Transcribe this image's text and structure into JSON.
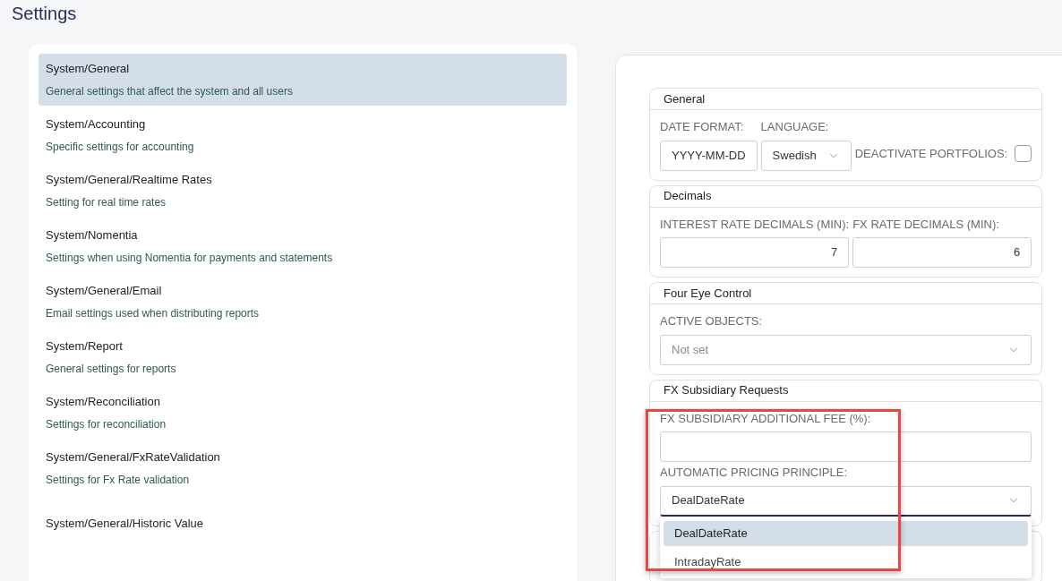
{
  "page_title": "Settings",
  "categories": [
    {
      "title": "System/General",
      "description": "General settings that affect the system and all users",
      "selected": true
    },
    {
      "title": "System/Accounting",
      "description": "Specific settings for accounting",
      "selected": false
    },
    {
      "title": "System/General/Realtime Rates",
      "description": "Setting for real time rates",
      "selected": false
    },
    {
      "title": "System/Nomentia",
      "description": "Settings when using Nomentia for payments and statements",
      "selected": false
    },
    {
      "title": "System/General/Email",
      "description": "Email settings used when distributing reports",
      "selected": false
    },
    {
      "title": "System/Report",
      "description": "General settings for reports",
      "selected": false
    },
    {
      "title": "System/Reconciliation",
      "description": "Settings for reconciliation",
      "selected": false
    },
    {
      "title": "System/General/FxRateValidation",
      "description": "Settings for Fx Rate validation",
      "selected": false
    },
    {
      "title": "System/General/Historic Value",
      "selected": false
    }
  ],
  "sections": [
    {
      "title": "General",
      "kind": "row",
      "fields": [
        {
          "kind": "text",
          "label": "DATE FORMAT:",
          "value": "YYYY-MM-DD"
        },
        {
          "kind": "select",
          "label": "LANGUAGE:",
          "value": "Swedish"
        },
        {
          "kind": "checkbox",
          "label": "DEACTIVATE PORTFOLIOS:",
          "checked": false
        }
      ]
    },
    {
      "title": "Decimals",
      "kind": "row",
      "fields": [
        {
          "kind": "number",
          "label": "INTEREST RATE DECIMALS (MIN):",
          "value": "7"
        },
        {
          "kind": "number",
          "label": "FX RATE DECIMALS (MIN):",
          "value": "6"
        }
      ]
    },
    {
      "title": "Four Eye Control",
      "kind": "column",
      "fields": [
        {
          "kind": "select",
          "label": "ACTIVE OBJECTS:",
          "placeholder": "Not set"
        }
      ]
    },
    {
      "title": "FX Subsidiary Requests",
      "kind": "column",
      "fields": [
        {
          "kind": "text",
          "label": "FX SUBSIDIARY ADDITIONAL FEE (%):"
        },
        {
          "kind": "select",
          "label": "AUTOMATIC PRICING PRINCIPLE:",
          "value": "DealDateRate",
          "open": true,
          "options": [
            {
              "label": "DealDateRate",
              "selected": true
            },
            {
              "label": "IntradayRate",
              "selected": false
            }
          ]
        }
      ]
    }
  ],
  "highlight": {
    "shown": true
  }
}
